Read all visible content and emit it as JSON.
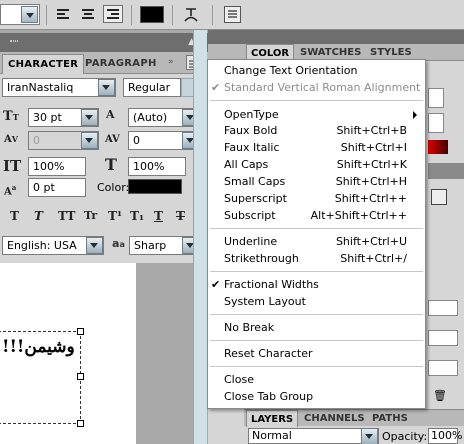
{
  "options_bar": {
    "text_color": "#000000"
  },
  "character_panel": {
    "tabs": [
      "CHARACTER",
      "PARAGRAPH"
    ],
    "font_family": "IranNastaliq",
    "font_style": "Regular",
    "font_size": "30 pt",
    "leading": "(Auto)",
    "kerning": "0",
    "tracking": "0",
    "vertical_scale": "100%",
    "horizontal_scale": "100%",
    "baseline_shift": "0 pt",
    "color_label": "Color:",
    "text_color": "#000000",
    "style_buttons": [
      "T",
      "T",
      "TT",
      "Tr",
      "T¹",
      "T₁",
      "T",
      "T"
    ],
    "language": "English: USA",
    "aa_label": "a",
    "antialias": "Sharp"
  },
  "canvas": {
    "text": "!!!وشیمن"
  },
  "right_panels": {
    "color_tabs": [
      "COLOR",
      "SWATCHES",
      "STYLES"
    ],
    "layers_tabs": [
      "LAYERS",
      "CHANNELS",
      "PATHS"
    ],
    "blend_mode": "Normal",
    "opacity_label": "Opacity:",
    "opacity_value": "100%"
  },
  "menu": {
    "items": [
      {
        "label": "Change Text Orientation",
        "shortcut": "",
        "disabled": false,
        "checked": false,
        "submenu": false
      },
      {
        "label": "Standard Vertical Roman Alignment",
        "shortcut": "",
        "disabled": true,
        "checked": true,
        "submenu": false
      },
      {
        "label": "OpenType",
        "shortcut": "",
        "disabled": false,
        "checked": false,
        "submenu": true
      },
      {
        "label": "Faux Bold",
        "shortcut": "Shift+Ctrl+B",
        "disabled": false,
        "checked": false,
        "submenu": false
      },
      {
        "label": "Faux Italic",
        "shortcut": "Shift+Ctrl+I",
        "disabled": false,
        "checked": false,
        "submenu": false
      },
      {
        "label": "All Caps",
        "shortcut": "Shift+Ctrl+K",
        "disabled": false,
        "checked": false,
        "submenu": false
      },
      {
        "label": "Small Caps",
        "shortcut": "Shift+Ctrl+H",
        "disabled": false,
        "checked": false,
        "submenu": false
      },
      {
        "label": "Superscript",
        "shortcut": "Shift+Ctrl++",
        "disabled": false,
        "checked": false,
        "submenu": false
      },
      {
        "label": "Subscript",
        "shortcut": "Alt+Shift+Ctrl++",
        "disabled": false,
        "checked": false,
        "submenu": false
      },
      {
        "label": "Underline",
        "shortcut": "Shift+Ctrl+U",
        "disabled": false,
        "checked": false,
        "submenu": false
      },
      {
        "label": "Strikethrough",
        "shortcut": "Shift+Ctrl+/",
        "disabled": false,
        "checked": false,
        "submenu": false
      },
      {
        "label": "Fractional Widths",
        "shortcut": "",
        "disabled": false,
        "checked": true,
        "submenu": false
      },
      {
        "label": "System Layout",
        "shortcut": "",
        "disabled": false,
        "checked": false,
        "submenu": false
      },
      {
        "label": "No Break",
        "shortcut": "",
        "disabled": false,
        "checked": false,
        "submenu": false
      },
      {
        "label": "Reset Character",
        "shortcut": "",
        "disabled": false,
        "checked": false,
        "submenu": false
      },
      {
        "label": "Close",
        "shortcut": "",
        "disabled": false,
        "checked": false,
        "submenu": false
      },
      {
        "label": "Close Tab Group",
        "shortcut": "",
        "disabled": false,
        "checked": false,
        "submenu": false
      }
    ],
    "check_glyph": "✔"
  }
}
